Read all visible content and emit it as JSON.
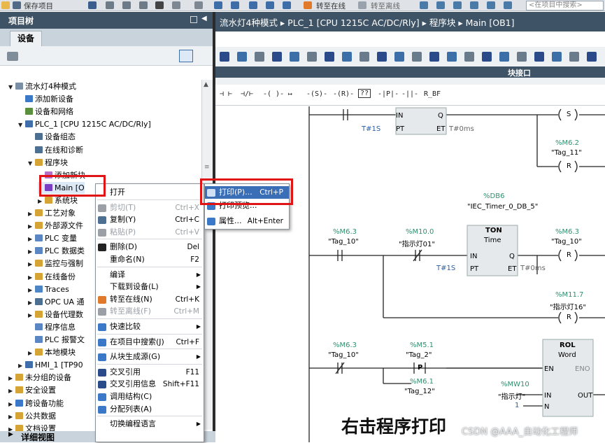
{
  "toolbar": {
    "save_project": "保存项目",
    "go_online": "转至在线",
    "go_offline": "转至离线",
    "search_placeholder": "<在项目中搜索>"
  },
  "left_panel": {
    "title": "项目树",
    "tab_devices": "设备",
    "tree": [
      {
        "label": "流水灯4种模式",
        "level": 0,
        "expand": "▼"
      },
      {
        "label": "添加新设备",
        "level": 1,
        "expand": ""
      },
      {
        "label": "设备和网络",
        "level": 1,
        "expand": ""
      },
      {
        "label": "PLC_1 [CPU 1215C AC/DC/Rly]",
        "level": 1,
        "expand": "▼"
      },
      {
        "label": "设备组态",
        "level": 2,
        "expand": ""
      },
      {
        "label": "在线和诊断",
        "level": 2,
        "expand": ""
      },
      {
        "label": "程序块",
        "level": 2,
        "expand": "▼"
      },
      {
        "label": "添加新块",
        "level": 3,
        "expand": ""
      },
      {
        "label": "Main [O",
        "level": 3,
        "expand": ""
      },
      {
        "label": "系统块",
        "level": 3,
        "expand": "▶"
      },
      {
        "label": "工艺对象",
        "level": 2,
        "expand": "▶"
      },
      {
        "label": "外部源文件",
        "level": 2,
        "expand": "▶"
      },
      {
        "label": "PLC 变量",
        "level": 2,
        "expand": "▶"
      },
      {
        "label": "PLC 数据类",
        "level": 2,
        "expand": "▶"
      },
      {
        "label": "监控与强制",
        "level": 2,
        "expand": "▶"
      },
      {
        "label": "在线备份",
        "level": 2,
        "expand": "▶"
      },
      {
        "label": "Traces",
        "level": 2,
        "expand": "▶"
      },
      {
        "label": "OPC UA 通",
        "level": 2,
        "expand": "▶"
      },
      {
        "label": "设备代理数",
        "level": 2,
        "expand": "▶"
      },
      {
        "label": "程序信息",
        "level": 2,
        "expand": ""
      },
      {
        "label": "PLC 报警文",
        "level": 2,
        "expand": ""
      },
      {
        "label": "本地模块",
        "level": 2,
        "expand": "▶"
      },
      {
        "label": "HMI_1 [TP90",
        "level": 1,
        "expand": "▶"
      },
      {
        "label": "未分组的设备",
        "level": 0,
        "expand": "▶"
      },
      {
        "label": "安全设置",
        "level": 0,
        "expand": "▶"
      },
      {
        "label": "跨设备功能",
        "level": 0,
        "expand": "▶"
      },
      {
        "label": "公共数据",
        "level": 0,
        "expand": "▶"
      },
      {
        "label": "文档设置",
        "level": 0,
        "expand": "▶"
      }
    ],
    "detail_view": "详细视图"
  },
  "editor": {
    "breadcrumb": "流水灯4种模式 ▸ PLC_1 [CPU 1215C AC/DC/Rly] ▸ 程序块 ▸ Main [OB1]",
    "block_interface": "块接口"
  },
  "context_menu": [
    {
      "label": "打开",
      "shortcut": "",
      "disabled": false,
      "arrow": false,
      "icon": ""
    },
    {
      "label": "剪切(T)",
      "shortcut": "Ctrl+X",
      "disabled": true,
      "arrow": false,
      "icon": "scissors-icon"
    },
    {
      "label": "复制(Y)",
      "shortcut": "Ctrl+C",
      "disabled": false,
      "arrow": false,
      "icon": "copy-icon"
    },
    {
      "label": "粘贴(P)",
      "shortcut": "Ctrl+V",
      "disabled": true,
      "arrow": false,
      "icon": "paste-icon"
    },
    {
      "label": "删除(D)",
      "shortcut": "Del",
      "disabled": false,
      "arrow": false,
      "icon": "delete-icon"
    },
    {
      "label": "重命名(N)",
      "shortcut": "F2",
      "disabled": false,
      "arrow": false,
      "icon": ""
    },
    {
      "label": "编译",
      "shortcut": "",
      "disabled": false,
      "arrow": true,
      "icon": ""
    },
    {
      "label": "下载到设备(L)",
      "shortcut": "",
      "disabled": false,
      "arrow": true,
      "icon": ""
    },
    {
      "label": "转至在线(N)",
      "shortcut": "Ctrl+K",
      "disabled": false,
      "arrow": false,
      "icon": "go-online-icon"
    },
    {
      "label": "转至离线(F)",
      "shortcut": "Ctrl+M",
      "disabled": true,
      "arrow": false,
      "icon": "go-offline-icon"
    },
    {
      "label": "快速比较",
      "shortcut": "",
      "disabled": false,
      "arrow": true,
      "icon": "compare-icon"
    },
    {
      "label": "在项目中搜索(J)",
      "shortcut": "Ctrl+F",
      "disabled": false,
      "arrow": false,
      "icon": "search-icon"
    },
    {
      "label": "从块生成源(G)",
      "shortcut": "",
      "disabled": false,
      "arrow": true,
      "icon": "generate-source-icon"
    },
    {
      "label": "交叉引用",
      "shortcut": "F11",
      "disabled": false,
      "arrow": false,
      "icon": "cross-reference-icon"
    },
    {
      "label": "交叉引用信息",
      "shortcut": "Shift+F11",
      "disabled": false,
      "arrow": false,
      "icon": "cross-reference-info-icon"
    },
    {
      "label": "调用结构(C)",
      "shortcut": "",
      "disabled": false,
      "arrow": false,
      "icon": "call-structure-icon"
    },
    {
      "label": "分配列表(A)",
      "shortcut": "",
      "disabled": false,
      "arrow": false,
      "icon": "assignment-list-icon"
    },
    {
      "label": "切换编程语言",
      "shortcut": "",
      "disabled": false,
      "arrow": true,
      "icon": ""
    }
  ],
  "submenu": [
    {
      "label": "打印(P)...",
      "shortcut": "Ctrl+P"
    },
    {
      "label": "打印预览...",
      "shortcut": ""
    },
    {
      "label": "属性...",
      "shortcut": "Alt+Enter"
    }
  ],
  "ladder": {
    "net1": {
      "in": "IN",
      "q": "Q",
      "pt": "PT",
      "et": "ET",
      "pt_val": "T#1S",
      "et_val": "T#0ms",
      "coil": "S",
      "reset_addr": "%M6.2",
      "reset_tag": "\"Tag_11\"",
      "reset_coil": "R"
    },
    "net2": {
      "db_addr": "%DB6",
      "db_name": "\"IEC_Timer_0_DB_5\"",
      "type": "TON",
      "sub": "Time",
      "c1_addr": "%M6.3",
      "c1_tag": "\"Tag_10\"",
      "c2_addr": "%M10.0",
      "c2_tag": "\"指示灯01\"",
      "pt_val": "T#1S",
      "et_val": "T#0ms",
      "q_addr": "%M6.3",
      "q_tag": "\"Tag_10\"",
      "r_coil": "R",
      "r2_addr": "%M11.7",
      "r2_tag": "\"指示灯16\"",
      "r2_coil": "R"
    },
    "net3": {
      "c1_addr": "%M6.3",
      "c1_tag": "\"Tag_10\"",
      "c2_addr": "%M5.1",
      "c2_tag": "\"Tag_2\"",
      "c3_addr": "%M6.1",
      "c3_tag": "\"Tag_12\"",
      "c2_sym": "P",
      "rol": "ROL",
      "rol_type": "Word",
      "en": "EN",
      "eno": "ENO",
      "in": "IN",
      "out": "OUT",
      "n": "N",
      "in_addr": "%MW10",
      "in_tag": "\"指示灯\"",
      "n_val": "1"
    }
  },
  "caption": "右击程序打印",
  "watermark": "CSDN @AAA_自动化工程师",
  "colors": {
    "header_bg": "#3e5365",
    "highlight_red": "#e01414",
    "selected_item": "#dde9f7"
  }
}
